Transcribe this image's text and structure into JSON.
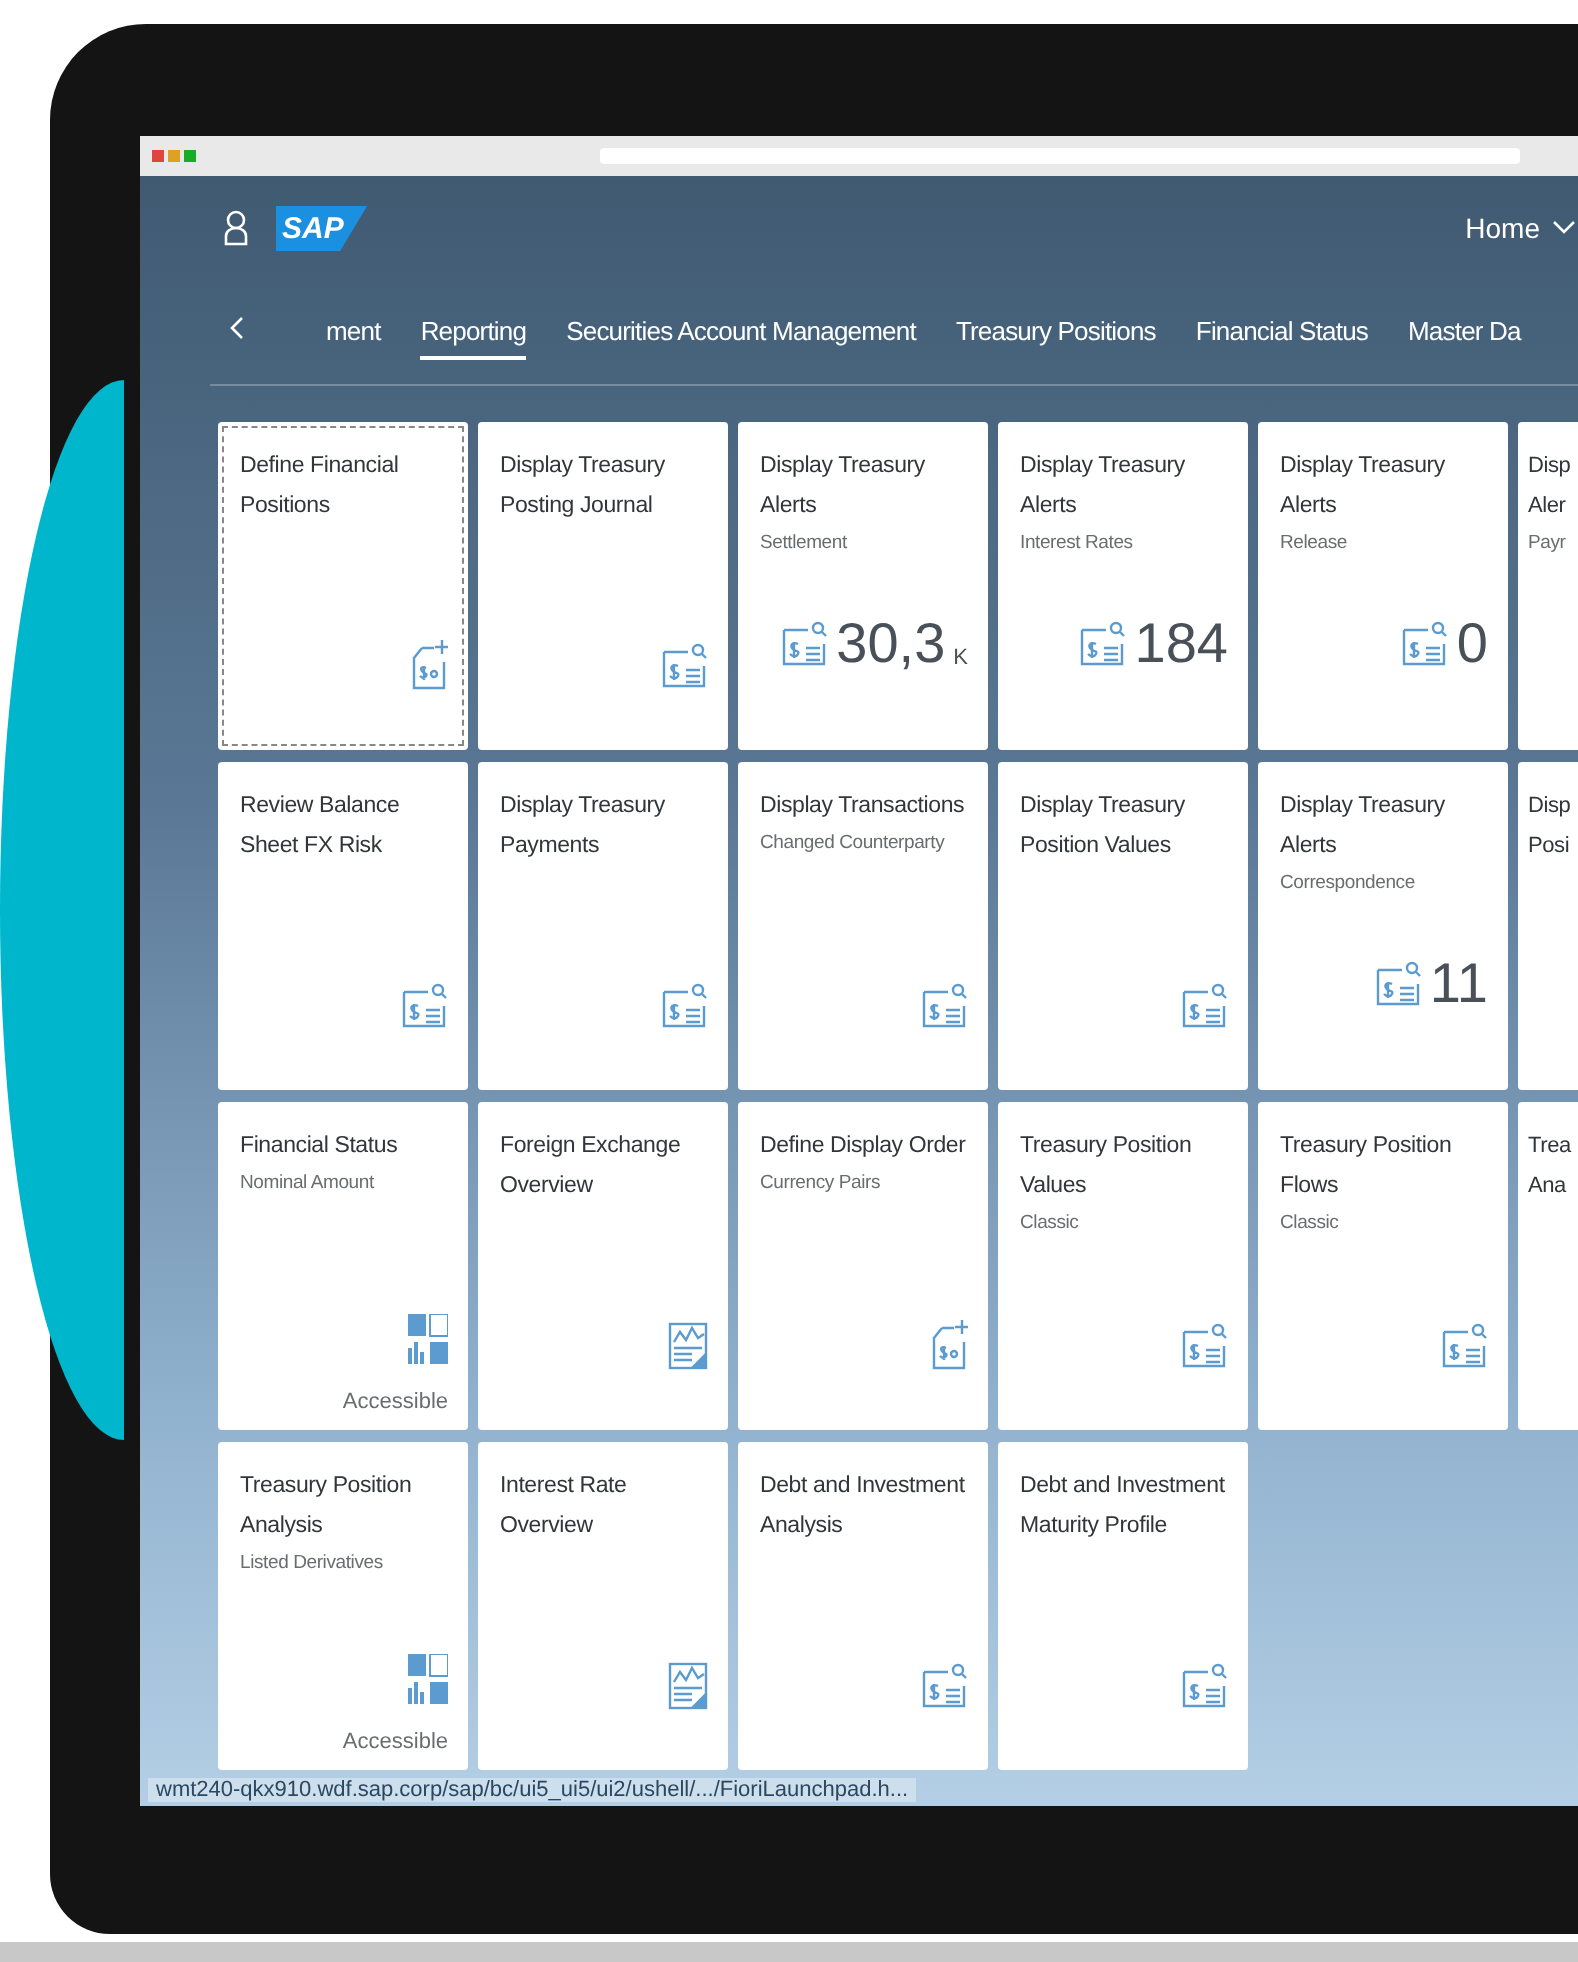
{
  "header": {
    "logo": "SAP",
    "home_menu": "Home"
  },
  "tabs": [
    {
      "label": "ment",
      "selected": false
    },
    {
      "label": "Reporting",
      "selected": true
    },
    {
      "label": "Securities Account Management",
      "selected": false
    },
    {
      "label": "Treasury Positions",
      "selected": false
    },
    {
      "label": "Financial Status",
      "selected": false
    },
    {
      "label": "Master Da",
      "selected": false
    }
  ],
  "tile_rows": [
    {
      "tiles": [
        {
          "kind": "new-document",
          "title": "Define Financial Positions",
          "focused": true
        },
        {
          "kind": "document",
          "title": "Display Treasury Posting Journal",
          "focused": false
        },
        {
          "kind": "document",
          "title": "Display Treasury Alerts",
          "subtitle": "Settlement",
          "number": "30,3",
          "unit": "K",
          "focused": false
        },
        {
          "kind": "document",
          "title": "Display Treasury Alerts",
          "subtitle": "Interest Rates",
          "number": "184",
          "focused": false
        },
        {
          "kind": "document",
          "title": "Display Treasury Alerts",
          "subtitle": "Release",
          "number": "0",
          "focused": false
        }
      ],
      "partial": {
        "lines": [
          "Disp",
          "Aler"
        ],
        "subtitle": "Payr"
      }
    },
    {
      "tiles": [
        {
          "kind": "document",
          "title": "Review Balance Sheet FX Risk",
          "focused": false
        },
        {
          "kind": "document",
          "title": "Display Treasury Payments",
          "focused": false
        },
        {
          "kind": "document",
          "title": "Display Transactions",
          "subtitle": "Changed Counterparty",
          "focused": false
        },
        {
          "kind": "document",
          "title": "Display Treasury Position Values",
          "focused": false
        },
        {
          "kind": "document",
          "title": "Display Treasury Alerts",
          "subtitle": "Correspondence",
          "number": "11",
          "focused": false
        }
      ],
      "partial": {
        "lines": [
          "Disp",
          "Posi"
        ]
      }
    },
    {
      "tiles": [
        {
          "kind": "dashboard",
          "title": "Financial Status",
          "subtitle": "Nominal Amount",
          "footer": "Accessible",
          "focused": false
        },
        {
          "kind": "chart",
          "title": "Foreign Exchange Overview",
          "focused": false
        },
        {
          "kind": "new-document",
          "title": "Define Display Order",
          "subtitle": "Currency Pairs",
          "focused": false
        },
        {
          "kind": "document",
          "title": "Treasury Position Values",
          "subtitle": "Classic",
          "focused": false
        },
        {
          "kind": "document",
          "title": "Treasury Position Flows",
          "subtitle": "Classic",
          "focused": false
        }
      ],
      "partial": {
        "lines": [
          "Trea",
          "Ana"
        ]
      }
    },
    {
      "tiles": [
        {
          "kind": "dashboard",
          "title": "Treasury Position Analysis",
          "subtitle": "Listed Derivatives",
          "footer": "Accessible",
          "focused": false
        },
        {
          "kind": "chart",
          "title": "Interest Rate Overview",
          "focused": false
        },
        {
          "kind": "document",
          "title": "Debt and Investment Analysis",
          "focused": false
        },
        {
          "kind": "document",
          "title": "Debt and Investment Maturity Profile",
          "focused": false
        }
      ]
    }
  ],
  "status_url": "wmt240-qkx910.wdf.sap.corp/sap/bc/ui5_ui5/ui2/ushell/.../FioriLaunchpad.h..."
}
